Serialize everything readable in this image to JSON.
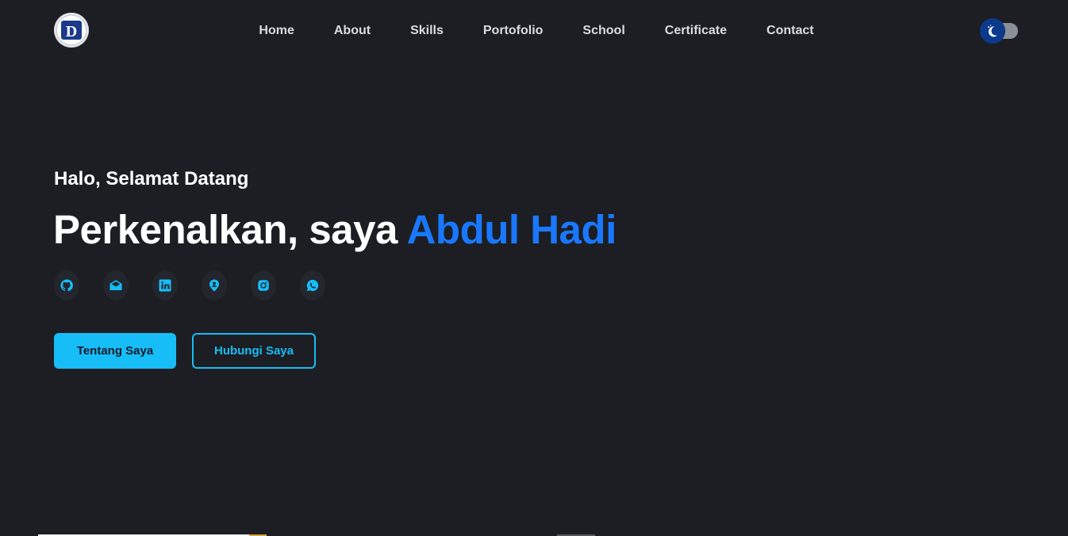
{
  "header": {
    "logo_letter": "D",
    "nav": [
      "Home",
      "About",
      "Skills",
      "Portofolio",
      "School",
      "Certificate",
      "Contact"
    ]
  },
  "hero": {
    "greeting": "Halo, Selamat Datang",
    "headline_prefix": "Perkenalkan, saya ",
    "headline_name": "Abdul Hadi",
    "socials": [
      "github-icon",
      "mail-icon",
      "linkedin-icon",
      "location-user-icon",
      "instagram-icon",
      "whatsapp-icon"
    ],
    "primary_button": "Tentang Saya",
    "secondary_button": "Hubungi Saya"
  },
  "colors": {
    "background": "#1c1e23",
    "accent": "#17bdf7",
    "name_blue": "#1a78ff",
    "toggle_knob": "#0a3a8c"
  }
}
